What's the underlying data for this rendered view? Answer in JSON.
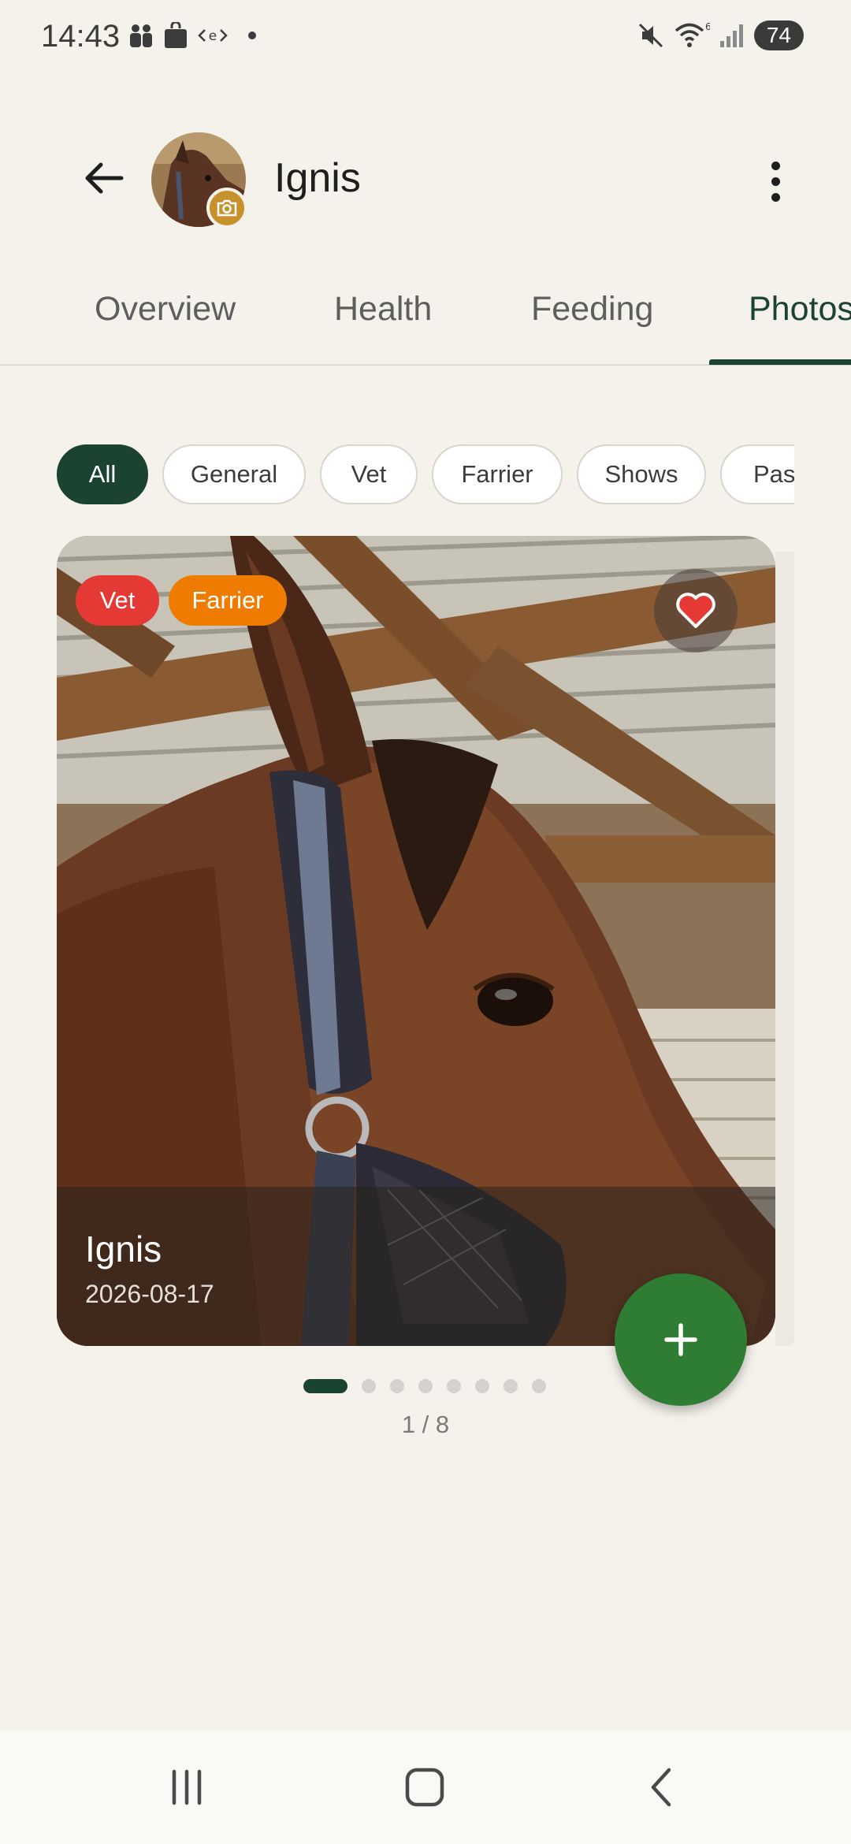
{
  "status_bar": {
    "time": "14:43",
    "left_icons": [
      "teams-icon",
      "bag-icon",
      "code-icon",
      "dot-icon"
    ],
    "right_icons": [
      "mute-icon",
      "wifi-icon",
      "signal-icon"
    ],
    "battery": "74"
  },
  "header": {
    "title": "Ignis",
    "back_icon": "arrow-left-icon",
    "menu_icon": "more-vert-icon",
    "avatar_badge_icon": "camera-icon"
  },
  "tabs": [
    {
      "label": "Overview",
      "active": false
    },
    {
      "label": "Health",
      "active": false
    },
    {
      "label": "Feeding",
      "active": false
    },
    {
      "label": "Photos",
      "active": true
    }
  ],
  "filters": [
    {
      "label": "All",
      "selected": true
    },
    {
      "label": "General",
      "selected": false
    },
    {
      "label": "Vet",
      "selected": false
    },
    {
      "label": "Farrier",
      "selected": false
    },
    {
      "label": "Shows",
      "selected": false
    },
    {
      "label": "Past",
      "selected": false
    }
  ],
  "photo": {
    "tags": [
      {
        "label": "Vet",
        "color": "#E53935"
      },
      {
        "label": "Farrier",
        "color": "#EF7C00"
      }
    ],
    "favorite": true,
    "name": "Ignis",
    "date": "2026-08-17"
  },
  "pager": {
    "total": 8,
    "current": 1,
    "counter_text": "1 / 8"
  },
  "fab": {
    "icon": "plus-icon"
  },
  "colors": {
    "background": "#F5F2EB",
    "primary": "#1B4332",
    "fab": "#2E7D32",
    "vet_tag": "#E53935",
    "farrier_tag": "#EF7C00",
    "heart": "#E53935"
  },
  "nav": {
    "icons": [
      "recents-icon",
      "home-icon",
      "back-icon"
    ]
  }
}
